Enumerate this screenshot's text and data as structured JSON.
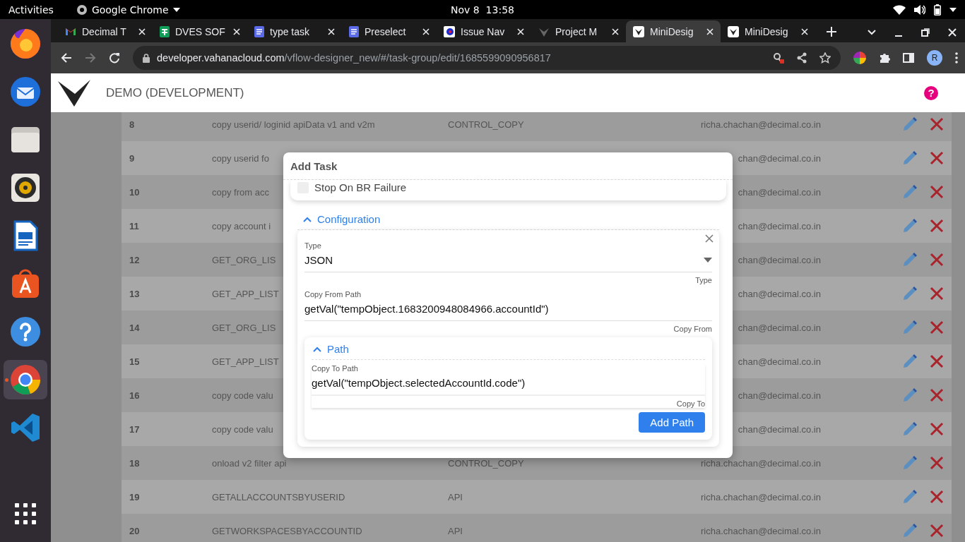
{
  "system_bar": {
    "activities": "Activities",
    "app_name": "Google Chrome",
    "clock": "Nov 8  13:58"
  },
  "dock": [
    {
      "kind": "firefox",
      "running": false
    },
    {
      "kind": "mail",
      "running": false
    },
    {
      "kind": "files",
      "running": false
    },
    {
      "kind": "music",
      "running": false
    },
    {
      "kind": "writer",
      "running": false
    },
    {
      "kind": "store",
      "running": false
    },
    {
      "kind": "help",
      "running": false
    },
    {
      "kind": "chrome",
      "running": true
    },
    {
      "kind": "code",
      "running": false
    },
    {
      "kind": "apps",
      "running": false
    }
  ],
  "browser": {
    "tabs": [
      {
        "title": "Decimal T",
        "kind": "mail",
        "selected": false
      },
      {
        "title": "DVES SOF",
        "kind": "sheet",
        "selected": false
      },
      {
        "title": "type task",
        "kind": "doc",
        "selected": false
      },
      {
        "title": "Preselect",
        "kind": "doc",
        "selected": false
      },
      {
        "title": "Issue Nav",
        "kind": "tracker",
        "selected": false
      },
      {
        "title": "Project M",
        "kind": "vlogo-dark",
        "selected": false
      },
      {
        "title": "MiniDesig",
        "kind": "vlogo",
        "selected": true
      },
      {
        "title": "MiniDesig",
        "kind": "vlogo",
        "selected": false
      }
    ],
    "url_host": "developer.vahanacloud.com",
    "url_path": "/vflow-designer_new/#/task-group/edit/1685599090956817",
    "avatar": "R"
  },
  "app_header": {
    "title": "DEMO (DEVELOPMENT)",
    "help": "?"
  },
  "table": {
    "rows": [
      {
        "number": "8",
        "name": "copy userid/ loginid apiData v1 and v2m",
        "type": "CONTROL_COPY",
        "email": "richa.chachan@decimal.co.in"
      },
      {
        "number": "9",
        "name": "copy userid fo",
        "email": "chan@decimal.co.in"
      },
      {
        "number": "10",
        "name": "copy from acc",
        "email": "chan@decimal.co.in"
      },
      {
        "number": "11",
        "name": "copy account i",
        "email": "chan@decimal.co.in"
      },
      {
        "number": "12",
        "name": "GET_ORG_LIS",
        "email": "chan@decimal.co.in"
      },
      {
        "number": "13",
        "name": "GET_APP_LIST",
        "email": "chan@decimal.co.in"
      },
      {
        "number": "14",
        "name": "GET_ORG_LIS",
        "email": "chan@decimal.co.in"
      },
      {
        "number": "15",
        "name": "GET_APP_LIST",
        "email": "chan@decimal.co.in"
      },
      {
        "number": "16",
        "name": "copy code valu",
        "email": "chan@decimal.co.in"
      },
      {
        "number": "17",
        "name": "copy code valu",
        "email": "chan@decimal.co.in"
      },
      {
        "number": "18",
        "name": "onload v2 filter api",
        "type": "CONTROL_COPY",
        "email": "richa.chachan@decimal.co.in"
      },
      {
        "number": "19",
        "name": "GETALLACCOUNTSBYUSERID",
        "type": "API",
        "email": "richa.chachan@decimal.co.in"
      },
      {
        "number": "20",
        "name": "GETWORKSPACESBYACCOUNTID",
        "type": "API",
        "email": "richa.chachan@decimal.co.in"
      }
    ]
  },
  "dialog": {
    "title": "Add Task",
    "stop_on_br": {
      "label": "Stop On BR Failure",
      "checked": false
    },
    "configuration": {
      "title": "Configuration",
      "expanded": true,
      "type_field": {
        "label": "Type",
        "value": "JSON",
        "hint": "Type"
      },
      "copy_from": {
        "label": "Copy From Path",
        "value": "getVal(\"tempObject.1683200948084966.accountId\")",
        "hint": "Copy From"
      },
      "path": {
        "title": "Path",
        "expanded": true,
        "copy_to": {
          "label": "Copy To Path",
          "value": "getVal(\"tempObject.selectedAccountId.code\")",
          "hint": "Copy To"
        },
        "add_button": "Add Path"
      }
    }
  }
}
